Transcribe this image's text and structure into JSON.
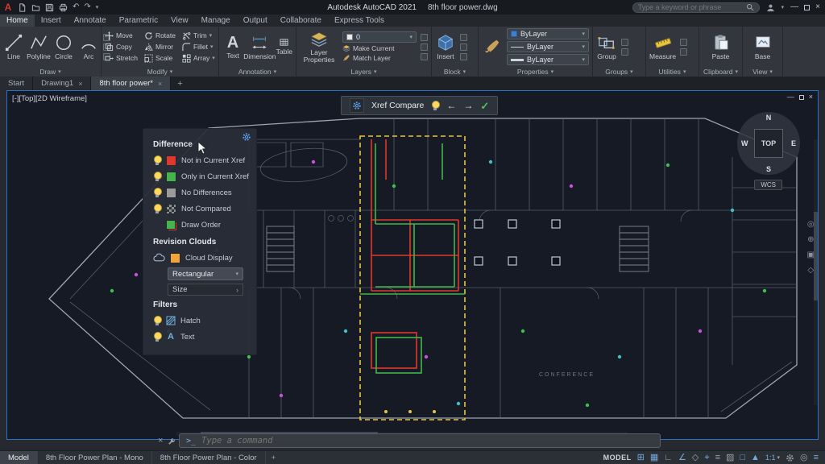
{
  "colors": {
    "accent_blue": "#2a72c8",
    "compare_red": "#e0382c",
    "compare_green": "#43b54a",
    "compare_gray": "#9b9b9b",
    "cloud_orange": "#f2a33c",
    "xref_boundary_yellow": "#e8c63e"
  },
  "titlebar": {
    "app_name": "Autodesk AutoCAD 2021",
    "doc_name": "8th floor power.dwg",
    "search_placeholder": "Type a keyword or phrase"
  },
  "menu_tabs": [
    "Home",
    "Insert",
    "Annotate",
    "Parametric",
    "View",
    "Manage",
    "Output",
    "Collaborate",
    "Express Tools"
  ],
  "ribbon": {
    "draw": {
      "panel_label": "Draw",
      "tools": [
        "Line",
        "Polyline",
        "Circle",
        "Arc"
      ]
    },
    "modify": {
      "panel_label": "Modify",
      "tools": [
        "Move",
        "Rotate",
        "Trim",
        "Copy",
        "Mirror",
        "Fillet",
        "Stretch",
        "Scale",
        "Array"
      ]
    },
    "annotation": {
      "panel_label": "Annotation",
      "text_tool": "Text",
      "text_glyph": "A",
      "dimension_tool": "Dimension",
      "table_tool": "Table"
    },
    "layers": {
      "panel_label": "Layers",
      "layer_properties": "Layer Properties",
      "current_layer": "0",
      "make_current": "Make Current",
      "match_layer": "Match Layer"
    },
    "block": {
      "panel_label": "Block",
      "insert_tool": "Insert"
    },
    "properties": {
      "panel_label": "Properties",
      "color_value": "ByLayer",
      "linetype_value": "ByLayer",
      "lineweight_value": "ByLayer"
    },
    "groups": {
      "panel_label": "Groups",
      "group_tool": "Group"
    },
    "utilities": {
      "panel_label": "Utilities",
      "measure_tool": "Measure"
    },
    "clipboard": {
      "panel_label": "Clipboard",
      "paste_tool": "Paste"
    },
    "view": {
      "panel_label": "View",
      "base_tool": "Base"
    }
  },
  "file_tabs": [
    "Start",
    "Drawing1",
    "8th floor power*"
  ],
  "viewport": {
    "label": "[-][Top][2D Wireframe]",
    "plan_room_label": "CONFERENCE",
    "compass": {
      "n": "N",
      "e": "E",
      "s": "S",
      "w": "W",
      "face": "TOP",
      "wcs": "WCS"
    }
  },
  "xref_toolbar": {
    "title": "Xref Compare"
  },
  "compare_panel": {
    "difference_title": "Difference",
    "difference_items": [
      {
        "label": "Not in Current Xref",
        "color": "#e0382c"
      },
      {
        "label": "Only in Current Xref",
        "color": "#43b54a"
      },
      {
        "label": "No Differences",
        "color": "#9b9b9b"
      },
      {
        "label": "Not Compared",
        "style": "checker"
      },
      {
        "label": "Draw Order",
        "style": "green-over-red"
      }
    ],
    "revision_clouds_title": "Revision Clouds",
    "cloud_display_label": "Cloud Display",
    "cloud_shape_value": "Rectangular",
    "size_label": "Size",
    "filters_title": "Filters",
    "filter_items": [
      "Hatch",
      "Text"
    ]
  },
  "command_line": {
    "placeholder": "Type a command"
  },
  "status_bar": {
    "model_tab": "Model",
    "layout_tabs": [
      "8th Floor Power Plan - Mono",
      "8th Floor Power Plan - Color"
    ],
    "mode_label": "MODEL",
    "annotation_scale": "1:1"
  },
  "status_icons": [
    {
      "glyph": "⊞"
    },
    {
      "glyph": "▦"
    },
    {
      "glyph": "∟"
    },
    {
      "glyph": "∠"
    },
    {
      "glyph": "◇"
    },
    {
      "glyph": "⌖"
    },
    {
      "glyph": "≡"
    },
    {
      "glyph": "▨"
    },
    {
      "glyph": "□"
    },
    {
      "glyph": "▲"
    },
    {
      "glyph": "◎"
    },
    {
      "glyph": "≡"
    }
  ],
  "glyphs": {
    "caret_down": "▾",
    "arrow_left": "←",
    "arrow_right": "→",
    "check": "✓",
    "close": "×",
    "minimize": "—",
    "undo": "↶",
    "redo": "↷",
    "plus": "+",
    "chevron_right": "›",
    "prompt": "&gt;_"
  }
}
